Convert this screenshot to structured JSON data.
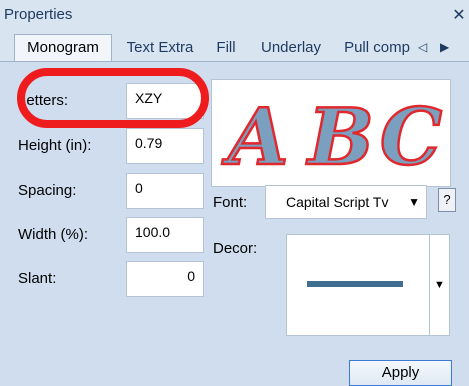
{
  "window": {
    "title": "Properties",
    "close_glyph": "✕"
  },
  "tabs": [
    {
      "label": "Monogram",
      "active": true
    },
    {
      "label": "Text Extra",
      "active": false
    },
    {
      "label": "Fill",
      "active": false
    },
    {
      "label": "Underlay",
      "active": false
    },
    {
      "label": "Pull comp",
      "active": false
    }
  ],
  "tab_scroll": {
    "left": "◁",
    "right": "▶"
  },
  "form": {
    "letters": {
      "label": "Letters:",
      "value": "XZY"
    },
    "height": {
      "label": "Height (in):",
      "value": "0.79"
    },
    "spacing": {
      "label": "Spacing:",
      "value": "0"
    },
    "width": {
      "label": "Width (%):",
      "value": "100.0"
    },
    "slant": {
      "label": "Slant:",
      "value": "0"
    }
  },
  "preview": {
    "letters": [
      "A",
      "B",
      "C"
    ],
    "fill_color": "#7a9fbf",
    "outline_color": "#e0282d"
  },
  "font": {
    "label": "Font:",
    "value": "Capital Script Tv",
    "help": "?"
  },
  "decor": {
    "label": "Decor:",
    "line_color": "#3f6e90"
  },
  "apply_label": "Apply",
  "annotation_color": "#ee1c1c"
}
